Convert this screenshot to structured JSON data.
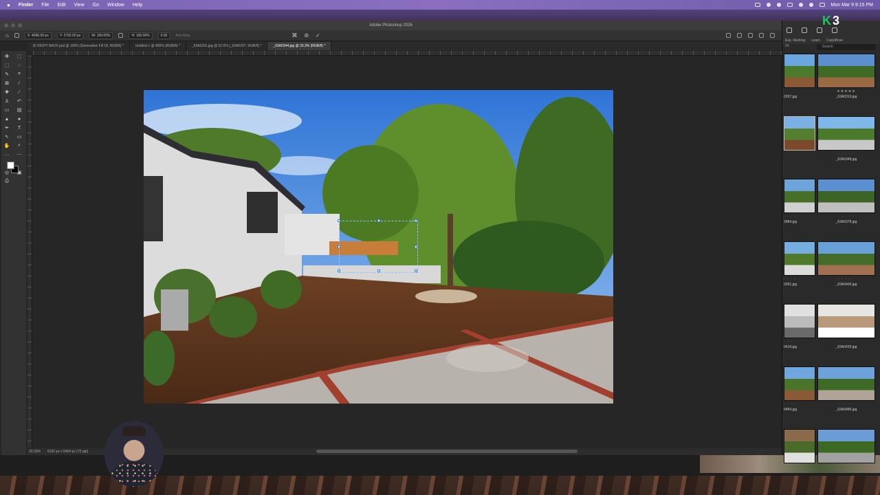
{
  "menubar": {
    "apple": "",
    "items": [
      "Finder",
      "File",
      "Edit",
      "View",
      "Go",
      "Window",
      "Help"
    ],
    "clock": "Mon Mar 9  9:15 PM"
  },
  "window": {
    "title": "Adobe Photoshop 2026"
  },
  "options": {
    "x": "X: 4096.00 px",
    "y": "Y: 2792.00 px",
    "w": "W: 100.00%",
    "h": "H: 100.00%",
    "angle": "0.00",
    "interp": "Anti-Alias"
  },
  "tabs": [
    "IE RIGHT BACK.psd @ 106% (Generative Fill 18, RGB/8) *",
    "Untitled-1 @ 455% (RGB/8) *",
    "_63A0291.jpg @ 52.5% (_63A0297, RGB/8) *",
    "_63A0344.jpg @ 33.3% (RGB/8) *"
  ],
  "status": {
    "zoom": "33.33%",
    "doc": "8192 px x 5464 px (72 ppi)"
  },
  "bridge": {
    "badge_k": "K",
    "badge_n": "3",
    "top_labels": [
      "Exp. Marking",
      "Learn",
      "CopyMove"
    ],
    "count": "94",
    "search_placeholder": "Search",
    "thumbs": [
      {
        "stars": "",
        "name": "0297.jpg"
      },
      {
        "stars": "★★★★★",
        "name": "_63A0319.jpg"
      },
      {
        "stars": "",
        "name": ""
      },
      {
        "stars": "· · · · ·",
        "name": "_63A0348.jpg"
      },
      {
        "stars": "· · · ·",
        "name": "3984.jpg"
      },
      {
        "stars": "· · · · ·",
        "name": "_63A0378.jpg"
      },
      {
        "stars": "· · · ·",
        "name": "0391.jpg"
      },
      {
        "stars": "· · · · ·",
        "name": "_63A0406.jpg"
      },
      {
        "stars": "· · · ·",
        "name": "0418.jpg"
      },
      {
        "stars": "· · · · ·",
        "name": "_63A0439.jpg"
      },
      {
        "stars": "· · · ·",
        "name": "9484.jpg"
      },
      {
        "stars": "· · · · ·",
        "name": "_63A0486.jpg"
      },
      {
        "stars": "",
        "name": ""
      },
      {
        "stars": "",
        "name": ""
      }
    ]
  }
}
